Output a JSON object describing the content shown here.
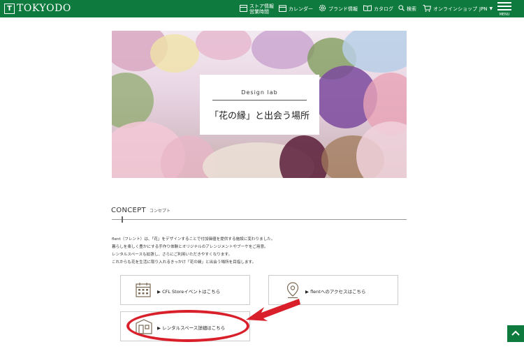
{
  "header": {
    "logo_mark": "T",
    "logo_text": "TOKYODO",
    "nav": {
      "store_line1": "ストア情報",
      "store_line2": "営業時間",
      "calendar": "カレンダー",
      "brand": "ブランド情報",
      "catalog": "カタログ",
      "search": "検索",
      "online_shop": "オンラインショップ",
      "language": "JPN"
    },
    "menu_label": "MENU"
  },
  "hero": {
    "subtitle": "Design lab",
    "title": "「花の縁」と出会う場所"
  },
  "concept": {
    "heading_en": "CONCEPT",
    "heading_jp": "コンセプト",
    "lines": [
      "flent（フレント）は、「花」をデザインすることで付加価値を提供する施設に変わりました。",
      "暮らしを楽しく豊かにする手作り体験とオリジナルのアレンジメントやブーケをご用意。",
      "レンタルスペースも拡張し、さらにご利用いただきやすくなります。",
      "これからも花を生活に取り入れるきっかけ「花の縁」と出会う場所を目指します。"
    ]
  },
  "links": {
    "events": "▶ CFL Storeイベントはこちら",
    "access": "▶ flentへのアクセスはこちら",
    "rental": "▶ レンタルスペース詳細はこちら"
  },
  "colors": {
    "brand_green": "#0f7a3e",
    "highlight_red": "#d81f2a"
  },
  "icons": {
    "calendar": "calendar-icon",
    "map_pin": "map-pin-icon",
    "rental_space": "building-icon",
    "to_top": "chevron-up-icon"
  }
}
